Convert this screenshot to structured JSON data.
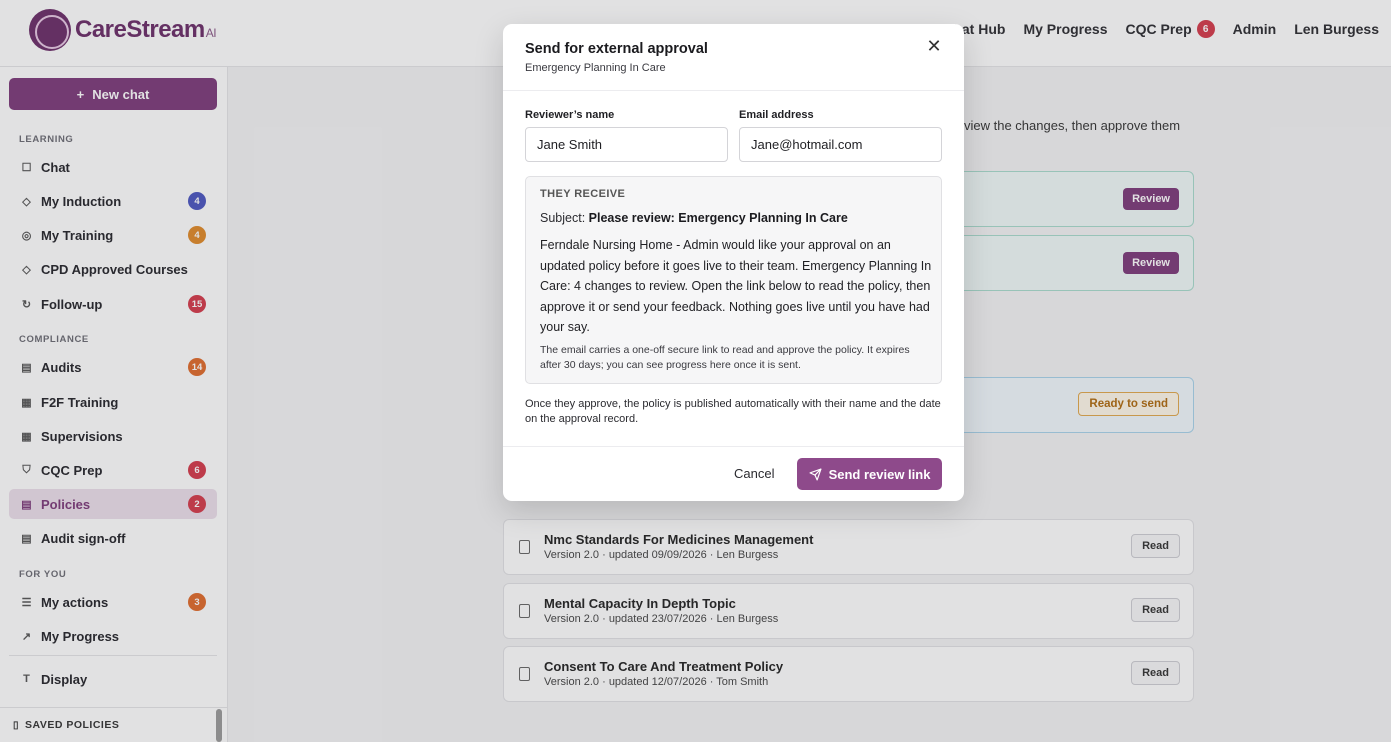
{
  "brand": {
    "name": "CareStream",
    "suffix": "AI"
  },
  "topnav": {
    "chat_hub": "Chat Hub",
    "my_progress": "My Progress",
    "cqc_prep": "CQC Prep",
    "cqc_prep_badge": "6",
    "admin": "Admin",
    "user": "Len Burgess"
  },
  "sidebar": {
    "new_chat": "New chat",
    "sections": {
      "learning": "LEARNING",
      "compliance": "COMPLIANCE",
      "for_you": "FOR YOU"
    },
    "items": [
      {
        "label": "Chat",
        "count": ""
      },
      {
        "label": "My Induction",
        "count": "4",
        "color": "#4a55c0"
      },
      {
        "label": "My Training",
        "count": "4",
        "color": "#e08a28"
      },
      {
        "label": "CPD Approved Courses",
        "count": ""
      },
      {
        "label": "Follow-up",
        "count": "15",
        "color": "#d43a4a"
      },
      {
        "label": "Audits",
        "count": "14",
        "color": "#e06a2a"
      },
      {
        "label": "F2F Training",
        "count": ""
      },
      {
        "label": "Supervisions",
        "count": ""
      },
      {
        "label": "CQC Prep",
        "count": "6",
        "color": "#d43a4a"
      },
      {
        "label": "Policies",
        "count": "2",
        "color": "#d43a4a"
      },
      {
        "label": "Audit sign-off",
        "count": ""
      },
      {
        "label": "My actions",
        "count": "3",
        "color": "#e06a2a"
      },
      {
        "label": "My Progress",
        "count": ""
      },
      {
        "label": "Display",
        "count": ""
      }
    ],
    "saved_policies": "SAVED POLICIES"
  },
  "main": {
    "intro_fragment": "view the changes, then approve them",
    "review_label": "Review",
    "ready_label": "Ready to send",
    "read_label": "Read",
    "policies": [
      {
        "title": "Nmc Standards For Medicines Management",
        "meta": "Version 2.0 · updated 09/09/2026 · Len Burgess"
      },
      {
        "title": "Mental Capacity In Depth Topic",
        "meta": "Version 2.0 · updated 23/07/2026 · Len Burgess"
      },
      {
        "title": "Consent To Care And Treatment Policy",
        "meta": "Version 2.0 · updated 12/07/2026 · Tom Smith"
      }
    ]
  },
  "modal": {
    "title": "Send for external approval",
    "subtitle": "Emergency Planning In Care",
    "reviewer_label": "Reviewer’s name",
    "reviewer_value": "Jane Smith",
    "email_label": "Email address",
    "email_value": "Jane@hotmail.com",
    "receive_heading": "THEY RECEIVE",
    "subject_prefix": "Subject:",
    "subject_value": "Please review: Emergency Planning In Care",
    "body": "Ferndale Nursing Home - Admin would like your approval on an updated policy before it goes live to their team. Emergency Planning In Care: 4 changes to review. Open the link below to read the policy, then approve it or send your feedback. Nothing goes live until you have had your say.",
    "link_note": "The email carries a one-off secure link to read and approve the policy. It expires after 30 days; you can see progress here once it is sent.",
    "after_note": "Once they approve, the policy is published automatically with their name and the date on the approval record.",
    "cancel": "Cancel",
    "send": "Send review link"
  }
}
